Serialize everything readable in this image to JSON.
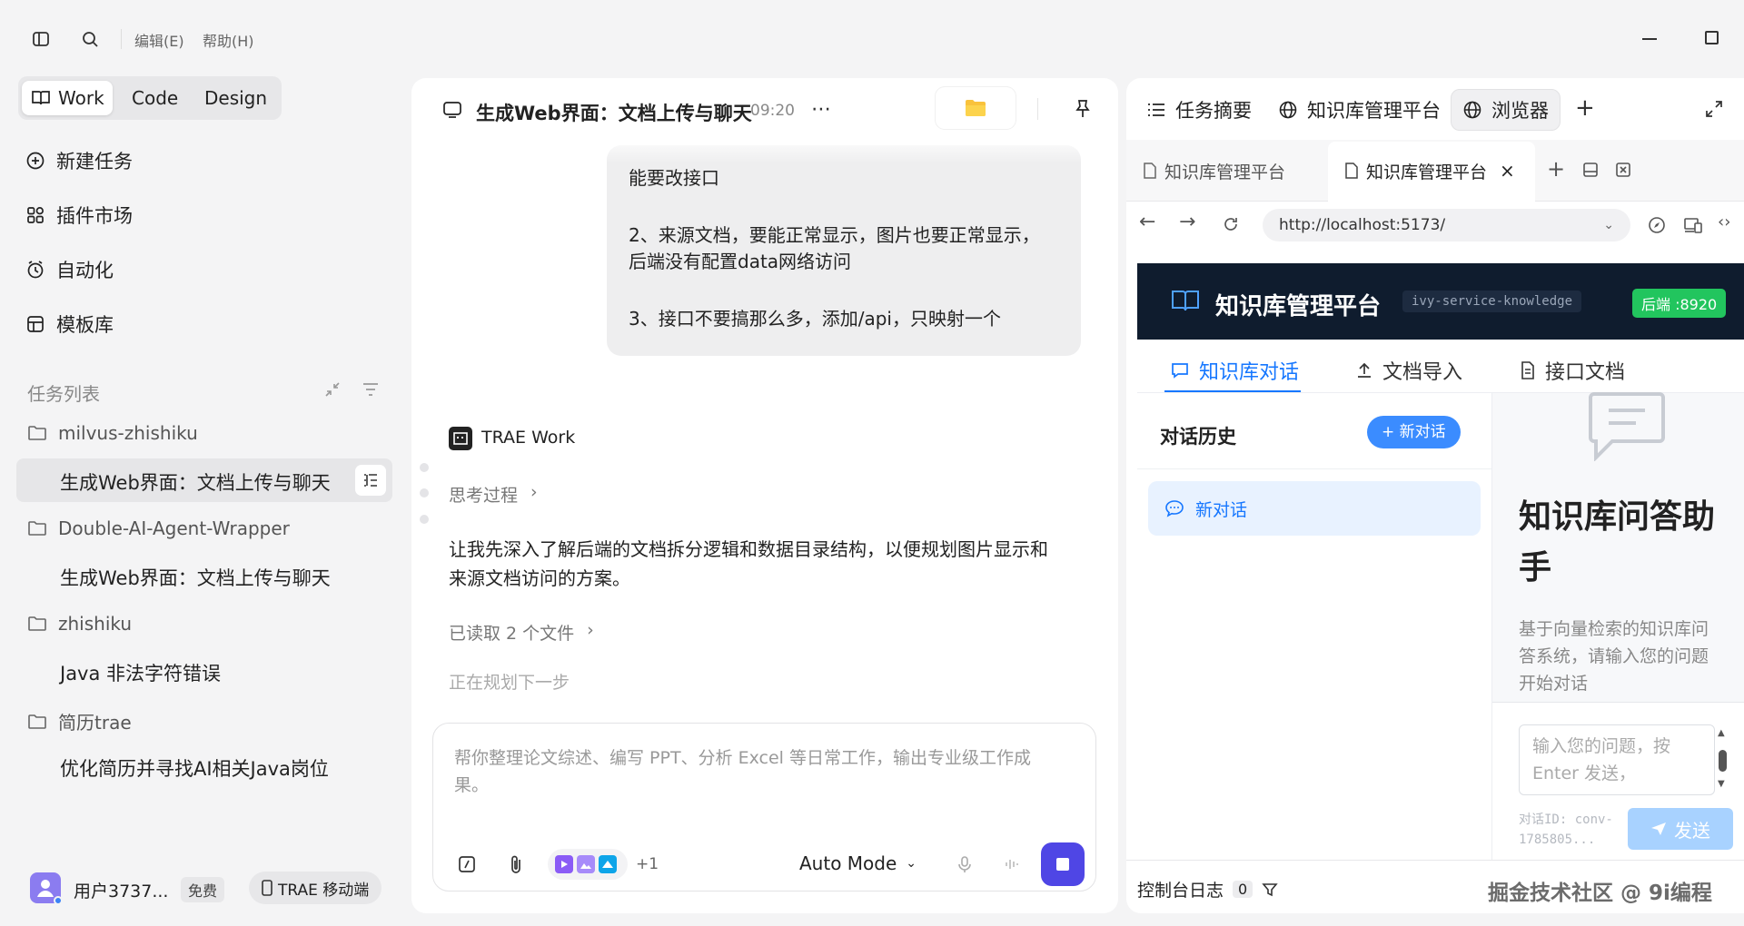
{
  "titlebar": {
    "menu_edit": "编辑(E)",
    "menu_help": "帮助(H)"
  },
  "sidebar": {
    "modes": [
      "Work",
      "Code",
      "Design"
    ],
    "nav": [
      {
        "label": "新建任务",
        "icon": "new-task-icon"
      },
      {
        "label": "插件市场",
        "icon": "plugin-icon"
      },
      {
        "label": "自动化",
        "icon": "clock-icon"
      },
      {
        "label": "模板库",
        "icon": "template-icon"
      }
    ],
    "tasks_title": "任务列表",
    "projects": [
      {
        "name": "milvus-zhishiku",
        "tasks": [
          "生成Web界面：文档上传与聊天"
        ]
      },
      {
        "name": "Double-AI-Agent-Wrapper",
        "tasks": [
          "生成Web界面：文档上传与聊天"
        ]
      },
      {
        "name": "zhishiku",
        "tasks": [
          "Java 非法字符错误"
        ]
      },
      {
        "name": "简历trae",
        "tasks": [
          "优化简历并寻找AI相关Java岗位"
        ]
      }
    ],
    "user": {
      "name": "用户3737...",
      "plan": "免费",
      "mobile": "TRAE 移动端"
    }
  },
  "chat": {
    "title": "生成Web界面：文档上传与聊天",
    "time": "09:20",
    "user_msg": [
      "能要改接口",
      "2、来源文档，要能正常显示，图片也要正常显示，",
      "后端没有配置data网络访问",
      "3、接口不要搞那么多，添加/api，只映射一个"
    ],
    "agent_name": "TRAE Work",
    "thinking": "思考过程",
    "reply": [
      "让我先深入了解后端的文档拆分逻辑和数据目录结构，以便规划图片显示和",
      "来源文档访问的方案。"
    ],
    "read_files": "已读取 2 个文件",
    "planning": "正在规划下一步",
    "composer_placeholder": [
      "帮你整理论文综述、编写 PPT、分析 Excel 等日常工作，输出专业级工作成",
      "果。"
    ],
    "plus_count": "+1",
    "mode": "Auto Mode"
  },
  "right": {
    "tabs": [
      "任务摘要",
      "知识库管理平台",
      "浏览器"
    ],
    "browser_tabs": [
      "知识库管理平台",
      "知识库管理平台"
    ],
    "url": "http://localhost:5173/",
    "app": {
      "title": "知识库管理平台",
      "service": "ivy-service-knowledge",
      "backend": "后端 :8920",
      "nav": [
        "知识库对话",
        "文档导入",
        "接口文档"
      ],
      "history_title": "对话历史",
      "new_chat_btn": "+ 新对话",
      "conv_item": "新对话",
      "hero_title": [
        "知识库问答助",
        "手"
      ],
      "hero_desc": [
        "基于向量检索的知识库问",
        "答系统，请输入您的问题",
        "开始对话"
      ],
      "input_placeholder": [
        "输入您的问题，按",
        "Enter 发送，"
      ],
      "conv_id": [
        "对话ID: conv-",
        "1785805..."
      ],
      "send": "发送"
    },
    "console": {
      "label": "控制台日志",
      "count": "0"
    },
    "watermark": "掘金技术社区 @ 9i编程"
  },
  "colors": {
    "accent": "#4f46e5",
    "kb_blue": "#1677ff",
    "kb_header": "#0f1c2e",
    "backend_green": "#22c55e"
  }
}
